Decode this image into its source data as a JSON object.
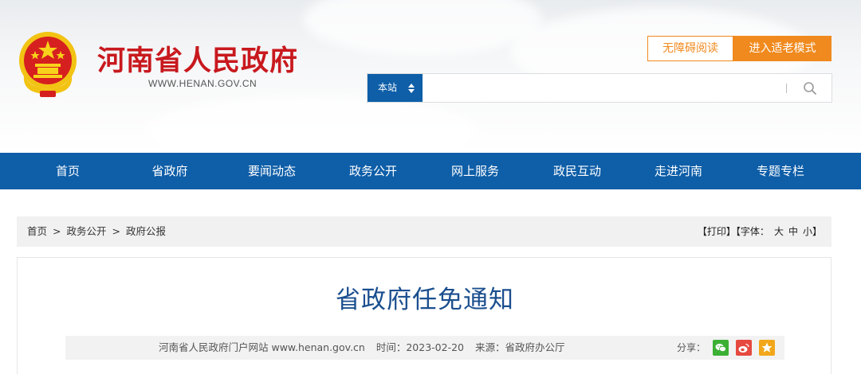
{
  "header": {
    "site_name": "河南省人民政府",
    "site_url": "WWW.HENAN.GOV.CN",
    "accessibility_label": "无障碍阅读",
    "elder_mode_label": "进入适老模式",
    "emblem_icon": "national-emblem-icon"
  },
  "search": {
    "scope_label": "本站",
    "scope_icon": "updown-caret-icon",
    "placeholder": "",
    "value": "",
    "button_icon": "search-icon"
  },
  "nav": {
    "items": [
      {
        "label": "首页"
      },
      {
        "label": "省政府"
      },
      {
        "label": "要闻动态"
      },
      {
        "label": "政务公开"
      },
      {
        "label": "网上服务"
      },
      {
        "label": "政民互动"
      },
      {
        "label": "走进河南"
      },
      {
        "label": "专题专栏"
      }
    ]
  },
  "breadcrumb": {
    "items": [
      "首页",
      "政务公开",
      "政府公报"
    ],
    "separator": ">"
  },
  "tools": {
    "print": "【打印】",
    "font_prefix": "【字体：",
    "sizes": [
      "大",
      "中",
      "小"
    ],
    "font_suffix": "】"
  },
  "article": {
    "title": "省政府任免通知",
    "source_site": "河南省人民政府门户网站 www.henan.gov.cn",
    "time_label": "时间：",
    "time": "2023-02-20",
    "origin_label": "来源：",
    "origin": "省政府办公厅",
    "share_label": "分享：",
    "share_icons": [
      "wechat-icon",
      "weibo-icon",
      "favorite-star-icon"
    ]
  },
  "colors": {
    "brand_blue": "#0e5ea8",
    "brand_red": "#c8191e",
    "accent_orange": "#f08a1e",
    "title_blue": "#1b4f8f"
  }
}
